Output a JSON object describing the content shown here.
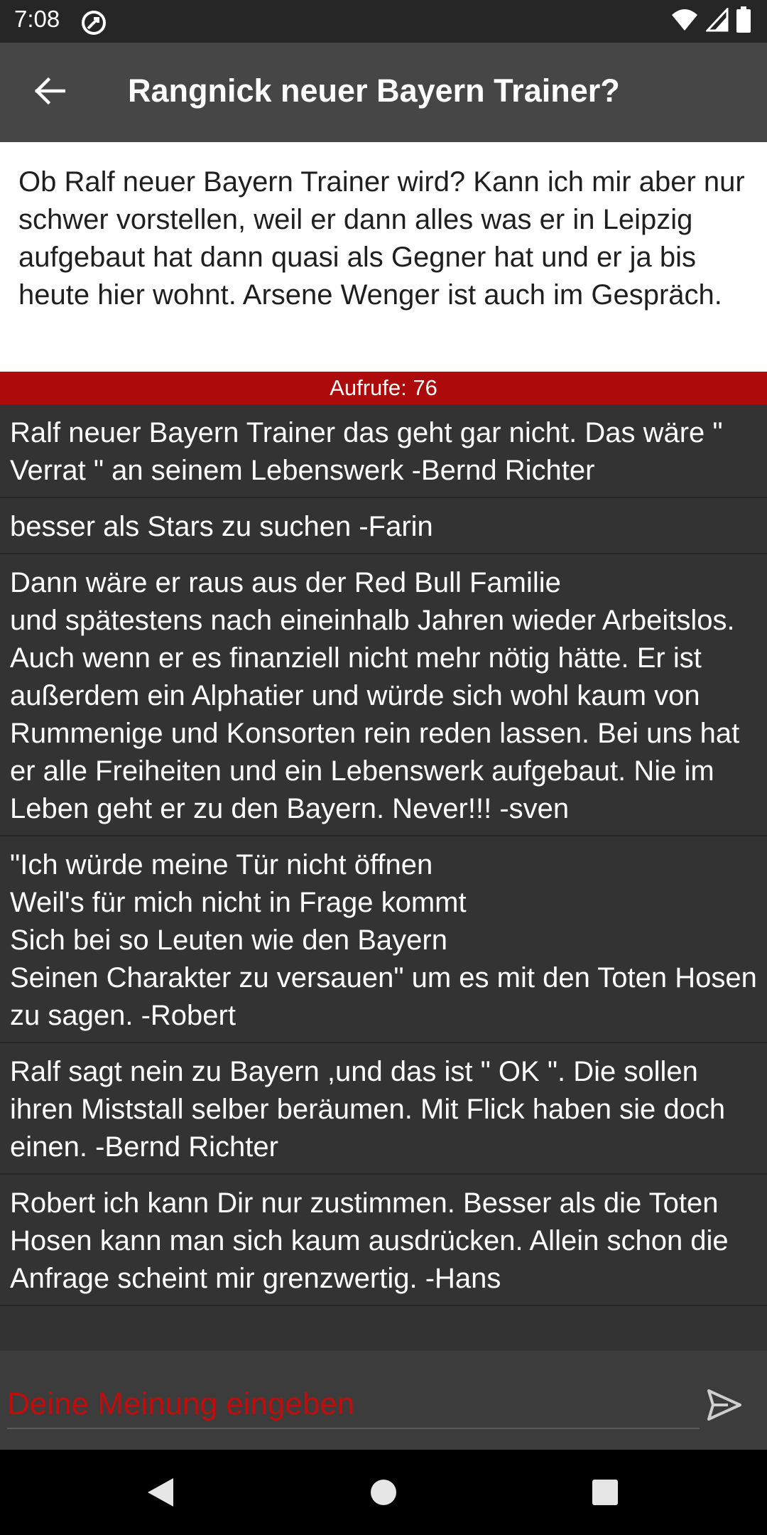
{
  "status_bar": {
    "time": "7:08",
    "icons": [
      "sync-icon",
      "wifi-icon",
      "signal-icon",
      "battery-icon"
    ]
  },
  "app_bar": {
    "back_icon": "arrow-left-icon",
    "title": "Rangnick neuer Bayern Trainer?"
  },
  "post": {
    "text": "Ob Ralf neuer Bayern Trainer wird? Kann ich mir aber nur schwer vorstellen, weil er dann alles was er in Leipzig aufgebaut hat dann quasi als Gegner hat und er ja bis heute hier wohnt.  Arsene Wenger ist auch im Gespräch."
  },
  "views": {
    "label": "Aufrufe: 76"
  },
  "comments": [
    "Ralf neuer Bayern Trainer das geht gar nicht. Das wäre \" Verrat \" an seinem Lebenswerk -Bernd Richter",
    "besser als Stars zu suchen -Farin",
    "Dann wäre er raus aus der Red Bull Familie\nund spätestens nach eineinhalb Jahren wieder Arbeitslos. Auch wenn er es finanziell nicht mehr nötig hätte. Er ist außerdem ein Alphatier und würde sich wohl kaum von Rummenige und Konsorten rein reden lassen. Bei uns hat er alle Freiheiten und ein Lebenswerk aufgebaut. Nie im Leben geht er zu den Bayern. Never!!! -sven",
    "\"Ich würde meine Tür nicht öffnen\nWeil's für mich nicht in Frage kommt\nSich bei so Leuten wie den Bayern\nSeinen Charakter zu versauen\" um es mit den Toten Hosen zu sagen. -Robert",
    "Ralf sagt nein zu Bayern ,und das ist \" OK \". Die sollen ihren Miststall selber beräumen. Mit Flick haben sie doch einen. -Bernd Richter",
    "Robert ich kann Dir nur zustimmen. Besser als die Toten Hosen kann man sich kaum ausdrücken. Allein schon die Anfrage scheint mir grenzwertig. -Hans"
  ],
  "composer": {
    "placeholder": "Deine Meinung eingeben",
    "value": "",
    "send_icon": "send-icon"
  },
  "nav_bar": {
    "icons": [
      "back-triangle-icon",
      "home-circle-icon",
      "recents-square-icon"
    ]
  },
  "colors": {
    "status_bar": "#262626",
    "app_bar": "#464646",
    "background": "#333333",
    "views_bar": "#ad0b0b",
    "placeholder": "#c20c0c",
    "nav_bar": "#000000"
  }
}
